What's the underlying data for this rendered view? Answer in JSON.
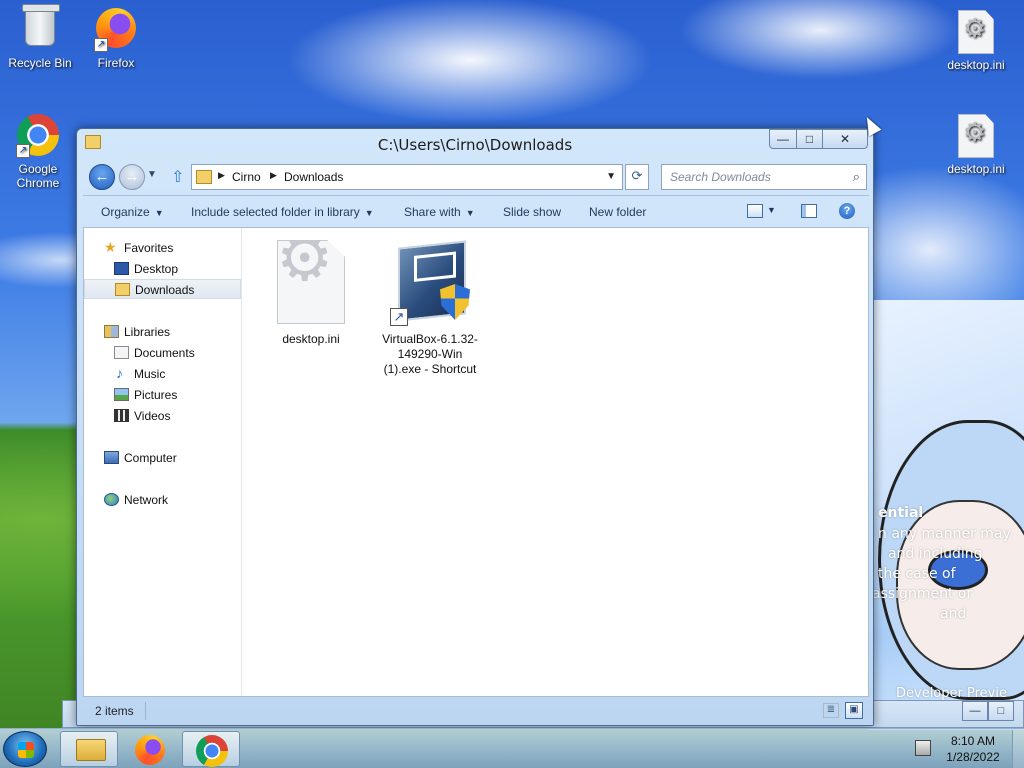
{
  "desktop": {
    "icons": [
      {
        "label": "Recycle Bin",
        "icon": "recycle-bin-icon"
      },
      {
        "label": "Firefox",
        "icon": "firefox-icon"
      },
      {
        "label": "Google Chrome",
        "icon": "chrome-icon"
      },
      {
        "label": "desktop.ini",
        "icon": "settings-file-icon"
      },
      {
        "label": "desktop.ini",
        "icon": "settings-file-icon"
      }
    ],
    "wallpaper_text": [
      "ential",
      "n any manner may",
      "and including",
      "the case of",
      "assignment or",
      "and",
      "Developer Previe"
    ]
  },
  "window": {
    "title": "C:\\Users\\Cirno\\Downloads",
    "controls": {
      "minimize": "—",
      "maximize": "□",
      "close": "✕"
    },
    "address": {
      "crumbs": [
        "Cirno",
        "Downloads"
      ]
    },
    "search": {
      "placeholder": "Search Downloads"
    },
    "toolbar": {
      "organize": "Organize",
      "include_library": "Include selected folder in library",
      "share_with": "Share with",
      "slide_show": "Slide show",
      "new_folder": "New folder",
      "help": "?"
    },
    "nav": {
      "favorites": "Favorites",
      "desktop": "Desktop",
      "downloads": "Downloads",
      "libraries": "Libraries",
      "documents": "Documents",
      "music": "Music",
      "pictures": "Pictures",
      "videos": "Videos",
      "computer": "Computer",
      "network": "Network"
    },
    "files": [
      {
        "name": "desktop.ini",
        "icon": "settings-file-icon"
      },
      {
        "name": "VirtualBox-6.1.32-149290-Win (1).exe - Shortcut",
        "icon": "virtualbox-installer-icon"
      }
    ],
    "status": {
      "count": "2 items"
    }
  },
  "taskbar": {
    "clock_time": "8:10 AM",
    "clock_date": "1/28/2022"
  },
  "colors": {
    "window_frame": "#bcd6f2",
    "selection": "#dfe7f0",
    "taskbar": "#a0bedc"
  }
}
